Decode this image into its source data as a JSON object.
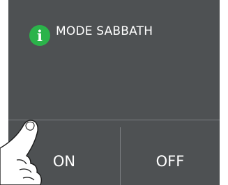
{
  "notice": {
    "icon": "info-icon",
    "icon_glyph": "i",
    "label": "MODE SABBATH",
    "icon_color": "#2bb34a"
  },
  "buttons": {
    "on_label": "ON",
    "off_label": "OFF"
  },
  "overlay": {
    "icon": "pointing-hand-icon"
  },
  "colors": {
    "panel_background": "#4e5153",
    "divider": "#7d8083",
    "text": "#ffffff"
  }
}
